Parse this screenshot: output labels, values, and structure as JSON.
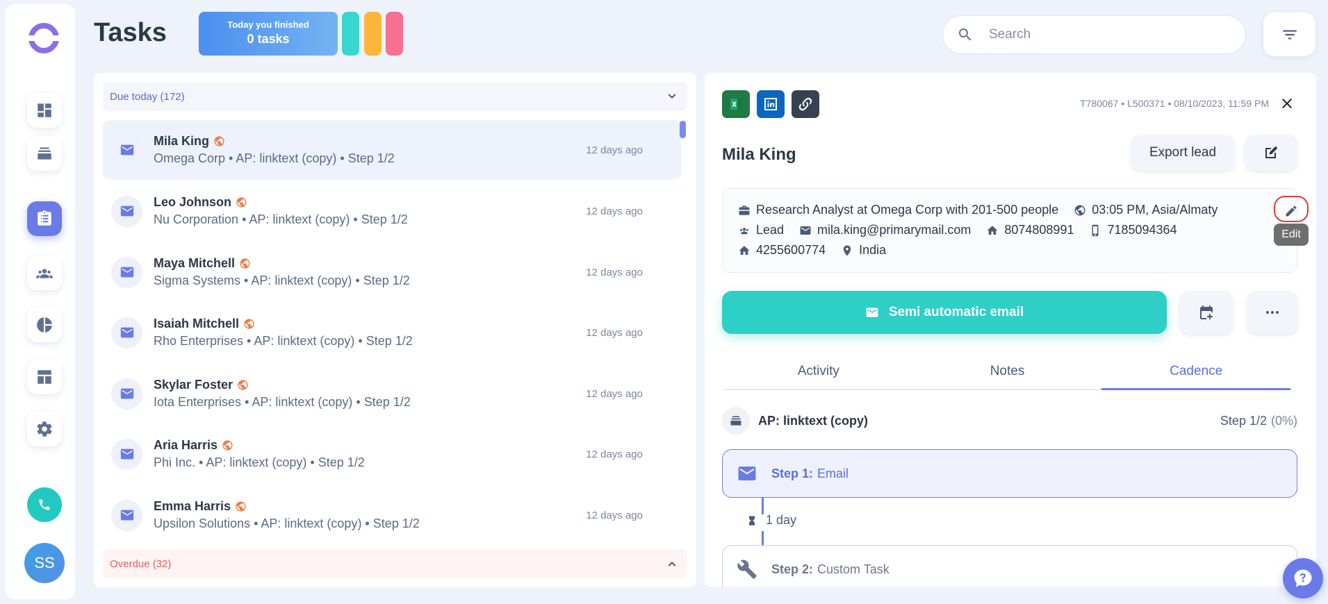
{
  "header": {
    "title": "Tasks",
    "finished_line1": "Today you finished",
    "finished_line2": "0 tasks",
    "pill_colors": [
      "#38d6cf",
      "#ffb43a",
      "#f7708f"
    ],
    "search_placeholder": "Search"
  },
  "sidebar": {
    "avatar_initials": "SS",
    "items": [
      "dashboard-icon",
      "cadences-icon",
      "tasks-icon",
      "leads-icon",
      "reports-icon",
      "templates-icon",
      "settings-icon"
    ],
    "active_item": "tasks-icon"
  },
  "task_list": {
    "due_group": "Due today (172)",
    "overdue_group": "Overdue (32)",
    "tasks": [
      {
        "name": "Mila King",
        "subtitle": "Omega Corp • AP: linktext (copy) • Step 1/2",
        "time": "12 days ago"
      },
      {
        "name": "Leo Johnson",
        "subtitle": "Nu Corporation • AP: linktext (copy) • Step 1/2",
        "time": "12 days ago"
      },
      {
        "name": "Maya Mitchell",
        "subtitle": "Sigma Systems • AP: linktext (copy) • Step 1/2",
        "time": "12 days ago"
      },
      {
        "name": "Isaiah Mitchell",
        "subtitle": "Rho Enterprises • AP: linktext (copy) • Step 1/2",
        "time": "12 days ago"
      },
      {
        "name": "Skylar Foster",
        "subtitle": "Iota Enterprises • AP: linktext (copy) • Step 1/2",
        "time": "12 days ago"
      },
      {
        "name": "Aria Harris",
        "subtitle": "Phi Inc. • AP: linktext (copy) • Step 1/2",
        "time": "12 days ago"
      },
      {
        "name": "Emma Harris",
        "subtitle": "Upsilon Solutions • AP: linktext (copy) • Step 1/2",
        "time": "12 days ago"
      }
    ]
  },
  "detail": {
    "meta": "T780067 • L500371 • 08/10/2023, 11:59 PM",
    "lead_name": "Mila King",
    "export_label": "Export lead",
    "info": {
      "job": "Research Analyst at Omega Corp with 201-500 people",
      "local_time": "03:05 PM, Asia/Almaty",
      "status": "Lead",
      "email": "mila.king@primarymail.com",
      "home_phone": "8074808991",
      "mobile": "7185094364",
      "phone2": "4255600774",
      "location": "India"
    },
    "edit_tooltip": "Edit",
    "action_label": "Semi automatic email",
    "tabs": [
      "Activity",
      "Notes",
      "Cadence"
    ],
    "active_tab": "Cadence",
    "cadence": {
      "name": "AP: linktext (copy)",
      "step": "Step 1/2",
      "percent": "(0%)",
      "step1_label": "Step 1:",
      "step1_type": "Email",
      "delay": "1 day",
      "step2_label": "Step 2:",
      "step2_type": "Custom Task"
    }
  }
}
